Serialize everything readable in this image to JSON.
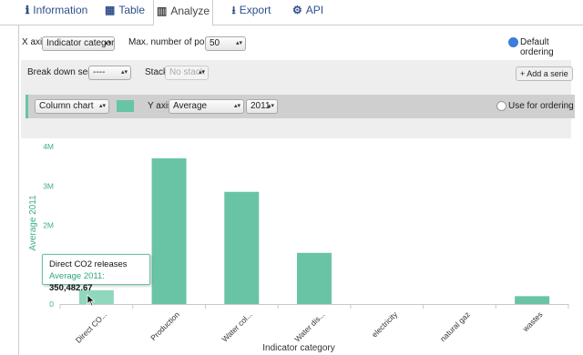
{
  "tabs": [
    {
      "label": "Information",
      "icon": "ℹ"
    },
    {
      "label": "Table",
      "icon": "▦"
    },
    {
      "label": "Analyze",
      "icon": "▥"
    },
    {
      "label": "Export",
      "icon": "⭳"
    },
    {
      "label": "API",
      "icon": "⚙"
    }
  ],
  "controls": {
    "x_axis_label": "X axis",
    "x_axis_value": "Indicator category",
    "max_points_label": "Max. number of points",
    "max_points_value": "50",
    "default_ordering": "Default ordering",
    "breakdown_label": "Break down series",
    "breakdown_value": "----",
    "stack_label": "Stack",
    "stack_value": "No stack",
    "add_serie": "+ Add a serie"
  },
  "serie": {
    "chart_type": "Column chart",
    "y_axis_label": "Y axis",
    "y_axis_value": "Average",
    "year_value": "2011",
    "use_for_ordering": "Use for ordering",
    "color": "#69c4a5"
  },
  "chart_data": {
    "type": "bar",
    "categories": [
      "Direct CO...",
      "Production",
      "Water col...",
      "Water dis...",
      "electricity",
      "natural gaz",
      "wastes"
    ],
    "values": [
      350482.67,
      3700000,
      2850000,
      1300000,
      0,
      0,
      200000
    ],
    "ylabel": "Average 2011",
    "xlabel": "Indicator category",
    "yticks": [
      "0",
      "1M",
      "2M",
      "3M",
      "4M"
    ],
    "ylim": [
      0,
      4000000
    ],
    "color": "#69c4a5"
  },
  "tooltip": {
    "title": "Direct CO2 releases",
    "series": "Average 2011",
    "value": "350,482.67"
  }
}
